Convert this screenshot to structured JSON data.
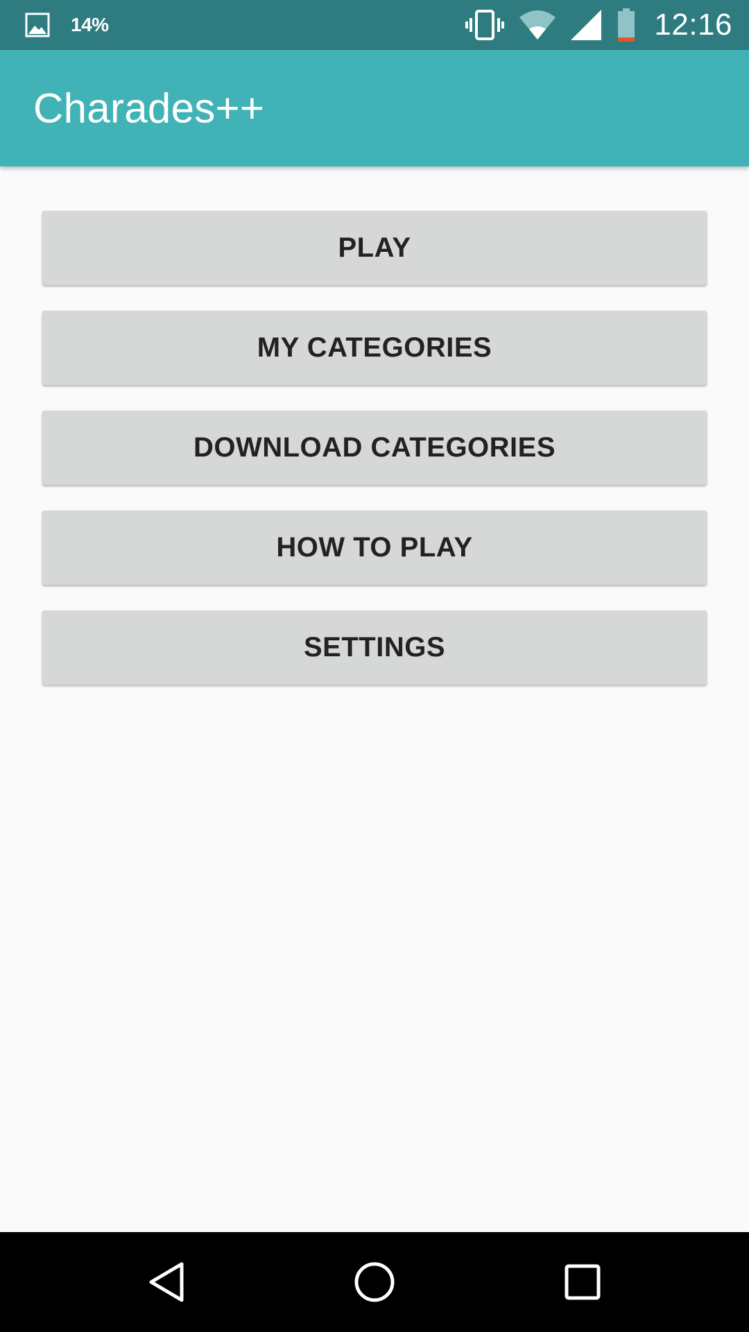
{
  "status_bar": {
    "battery_percent": "14%",
    "time": "12:16",
    "icons": [
      "image-notification-icon",
      "vibrate-icon",
      "wifi-icon",
      "cell-signal-icon",
      "battery-icon"
    ],
    "background_color": "#2e7b80"
  },
  "app_bar": {
    "title": "Charades++",
    "background_color": "#41b3b6"
  },
  "menu": {
    "buttons": [
      {
        "label": "PLAY"
      },
      {
        "label": "MY CATEGORIES"
      },
      {
        "label": "DOWNLOAD CATEGORIES"
      },
      {
        "label": "HOW TO PLAY"
      },
      {
        "label": "SETTINGS"
      }
    ],
    "button_color": "#d6d7d7",
    "text_color": "#222222"
  },
  "nav_bar": {
    "icons": [
      "back-icon",
      "home-icon",
      "recents-icon"
    ]
  }
}
